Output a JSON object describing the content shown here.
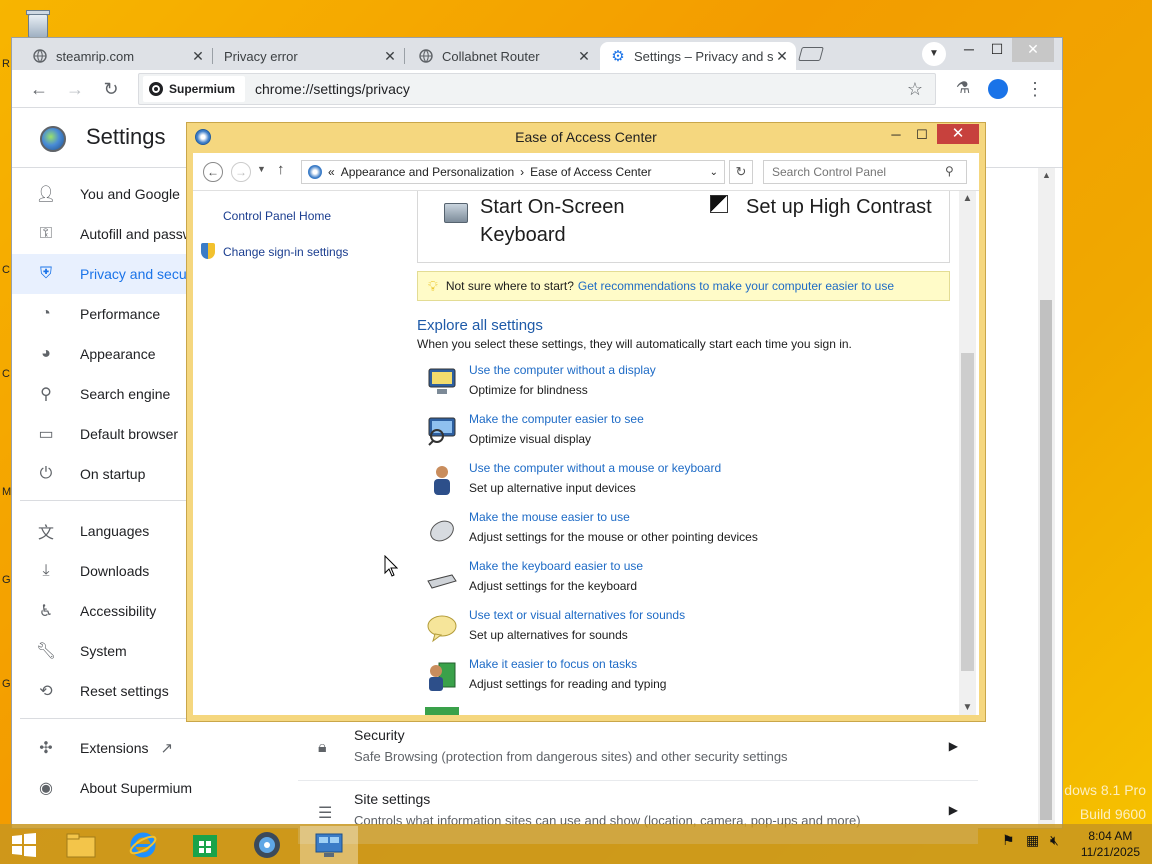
{
  "desktop": {
    "watermark_line1": "dows 8.1 Pro",
    "watermark_line2": "Build 9600"
  },
  "browser": {
    "tabs": [
      {
        "title": "steamrip.com",
        "icon": "globe-icon"
      },
      {
        "title": "Privacy error",
        "icon": "none"
      },
      {
        "title": "Collabnet Router",
        "icon": "globe-icon"
      },
      {
        "title": "Settings – Privacy and s",
        "icon": "gear-icon"
      }
    ],
    "omnibox_chip": "Supermium",
    "url": "chrome://settings/privacy"
  },
  "settings": {
    "title": "Settings",
    "sidebar": [
      {
        "label": "You and Google",
        "icon": "person-icon"
      },
      {
        "label": "Autofill and passwords",
        "icon": "key-icon"
      },
      {
        "label": "Privacy and security",
        "icon": "shield-icon"
      },
      {
        "label": "Performance",
        "icon": "gauge-icon"
      },
      {
        "label": "Appearance",
        "icon": "palette-icon"
      },
      {
        "label": "Search engine",
        "icon": "search-icon"
      },
      {
        "label": "Default browser",
        "icon": "browser-icon"
      },
      {
        "label": "On startup",
        "icon": "power-icon"
      },
      {
        "label": "Languages",
        "icon": "translate-icon"
      },
      {
        "label": "Downloads",
        "icon": "download-icon"
      },
      {
        "label": "Accessibility",
        "icon": "accessibility-icon"
      },
      {
        "label": "System",
        "icon": "wrench-icon"
      },
      {
        "label": "Reset settings",
        "icon": "reset-icon"
      },
      {
        "label": "Extensions",
        "icon": "puzzle-icon"
      },
      {
        "label": "About Supermium",
        "icon": "supermium-icon"
      }
    ],
    "rows": [
      {
        "title": "Security",
        "subtitle": "Safe Browsing (protection from dangerous sites) and other security settings"
      },
      {
        "title": "Site settings",
        "subtitle": "Controls what information sites can use and show (location, camera, pop-ups and more)"
      }
    ]
  },
  "control_panel": {
    "title": "Ease of Access Center",
    "breadcrumb": [
      "Appearance and Personalization",
      "Ease of Access Center"
    ],
    "breadcrumb_prefix": "«",
    "search_placeholder": "Search Control Panel",
    "left_links": [
      "Control Panel Home",
      "Change sign-in settings"
    ],
    "quick_options": [
      {
        "label_line1": "Start On-Screen",
        "label_line2": "Keyboard"
      },
      {
        "label_line1": "Set up High Contrast",
        "label_line2": ""
      }
    ],
    "tip_text": "Not sure where to start?",
    "tip_link": "Get recommendations to make your computer easier to use",
    "explore_title": "Explore all settings",
    "explore_desc": "When you select these settings, they will automatically start each time you sign in.",
    "options": [
      {
        "link": "Use the computer without a display",
        "desc": "Optimize for blindness",
        "icon": "monitor-icon"
      },
      {
        "link": "Make the computer easier to see",
        "desc": "Optimize visual display",
        "icon": "magnifier-monitor-icon"
      },
      {
        "link": "Use the computer without a mouse or keyboard",
        "desc": "Set up alternative input devices",
        "icon": "person-icon"
      },
      {
        "link": "Make the mouse easier to use",
        "desc": "Adjust settings for the mouse or other pointing devices",
        "icon": "mouse-icon"
      },
      {
        "link": "Make the keyboard easier to use",
        "desc": "Adjust settings for the keyboard",
        "icon": "keyboard-icon"
      },
      {
        "link": "Use text or visual alternatives for sounds",
        "desc": "Set up alternatives for sounds",
        "icon": "speech-bubble-icon"
      },
      {
        "link": "Make it easier to focus on tasks",
        "desc": "Adjust settings for reading and typing",
        "icon": "focus-icon"
      }
    ]
  },
  "taskbar": {
    "apps": [
      "file-explorer-icon",
      "internet-explorer-icon",
      "store-icon",
      "supermium-icon",
      "control-panel-icon"
    ],
    "time": "8:04 AM",
    "date": "11/21/2025"
  }
}
